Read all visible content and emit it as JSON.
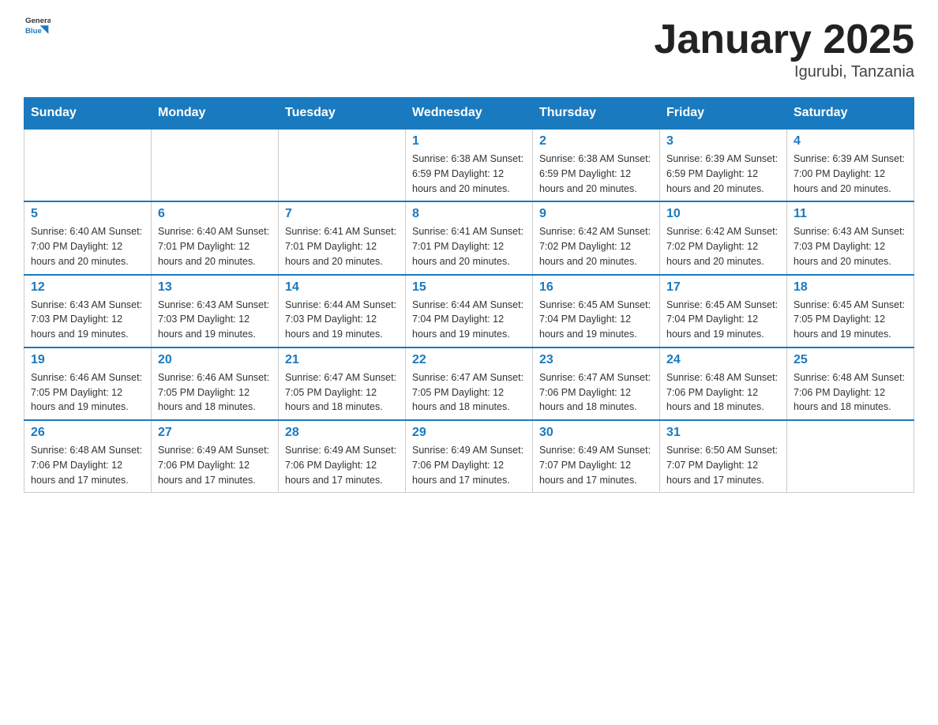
{
  "header": {
    "logo_text_general": "General",
    "logo_text_blue": "Blue",
    "month_title": "January 2025",
    "location": "Igurubi, Tanzania"
  },
  "weekdays": [
    "Sunday",
    "Monday",
    "Tuesday",
    "Wednesday",
    "Thursday",
    "Friday",
    "Saturday"
  ],
  "weeks": [
    [
      {
        "day": "",
        "info": ""
      },
      {
        "day": "",
        "info": ""
      },
      {
        "day": "",
        "info": ""
      },
      {
        "day": "1",
        "info": "Sunrise: 6:38 AM\nSunset: 6:59 PM\nDaylight: 12 hours\nand 20 minutes."
      },
      {
        "day": "2",
        "info": "Sunrise: 6:38 AM\nSunset: 6:59 PM\nDaylight: 12 hours\nand 20 minutes."
      },
      {
        "day": "3",
        "info": "Sunrise: 6:39 AM\nSunset: 6:59 PM\nDaylight: 12 hours\nand 20 minutes."
      },
      {
        "day": "4",
        "info": "Sunrise: 6:39 AM\nSunset: 7:00 PM\nDaylight: 12 hours\nand 20 minutes."
      }
    ],
    [
      {
        "day": "5",
        "info": "Sunrise: 6:40 AM\nSunset: 7:00 PM\nDaylight: 12 hours\nand 20 minutes."
      },
      {
        "day": "6",
        "info": "Sunrise: 6:40 AM\nSunset: 7:01 PM\nDaylight: 12 hours\nand 20 minutes."
      },
      {
        "day": "7",
        "info": "Sunrise: 6:41 AM\nSunset: 7:01 PM\nDaylight: 12 hours\nand 20 minutes."
      },
      {
        "day": "8",
        "info": "Sunrise: 6:41 AM\nSunset: 7:01 PM\nDaylight: 12 hours\nand 20 minutes."
      },
      {
        "day": "9",
        "info": "Sunrise: 6:42 AM\nSunset: 7:02 PM\nDaylight: 12 hours\nand 20 minutes."
      },
      {
        "day": "10",
        "info": "Sunrise: 6:42 AM\nSunset: 7:02 PM\nDaylight: 12 hours\nand 20 minutes."
      },
      {
        "day": "11",
        "info": "Sunrise: 6:43 AM\nSunset: 7:03 PM\nDaylight: 12 hours\nand 20 minutes."
      }
    ],
    [
      {
        "day": "12",
        "info": "Sunrise: 6:43 AM\nSunset: 7:03 PM\nDaylight: 12 hours\nand 19 minutes."
      },
      {
        "day": "13",
        "info": "Sunrise: 6:43 AM\nSunset: 7:03 PM\nDaylight: 12 hours\nand 19 minutes."
      },
      {
        "day": "14",
        "info": "Sunrise: 6:44 AM\nSunset: 7:03 PM\nDaylight: 12 hours\nand 19 minutes."
      },
      {
        "day": "15",
        "info": "Sunrise: 6:44 AM\nSunset: 7:04 PM\nDaylight: 12 hours\nand 19 minutes."
      },
      {
        "day": "16",
        "info": "Sunrise: 6:45 AM\nSunset: 7:04 PM\nDaylight: 12 hours\nand 19 minutes."
      },
      {
        "day": "17",
        "info": "Sunrise: 6:45 AM\nSunset: 7:04 PM\nDaylight: 12 hours\nand 19 minutes."
      },
      {
        "day": "18",
        "info": "Sunrise: 6:45 AM\nSunset: 7:05 PM\nDaylight: 12 hours\nand 19 minutes."
      }
    ],
    [
      {
        "day": "19",
        "info": "Sunrise: 6:46 AM\nSunset: 7:05 PM\nDaylight: 12 hours\nand 19 minutes."
      },
      {
        "day": "20",
        "info": "Sunrise: 6:46 AM\nSunset: 7:05 PM\nDaylight: 12 hours\nand 18 minutes."
      },
      {
        "day": "21",
        "info": "Sunrise: 6:47 AM\nSunset: 7:05 PM\nDaylight: 12 hours\nand 18 minutes."
      },
      {
        "day": "22",
        "info": "Sunrise: 6:47 AM\nSunset: 7:05 PM\nDaylight: 12 hours\nand 18 minutes."
      },
      {
        "day": "23",
        "info": "Sunrise: 6:47 AM\nSunset: 7:06 PM\nDaylight: 12 hours\nand 18 minutes."
      },
      {
        "day": "24",
        "info": "Sunrise: 6:48 AM\nSunset: 7:06 PM\nDaylight: 12 hours\nand 18 minutes."
      },
      {
        "day": "25",
        "info": "Sunrise: 6:48 AM\nSunset: 7:06 PM\nDaylight: 12 hours\nand 18 minutes."
      }
    ],
    [
      {
        "day": "26",
        "info": "Sunrise: 6:48 AM\nSunset: 7:06 PM\nDaylight: 12 hours\nand 17 minutes."
      },
      {
        "day": "27",
        "info": "Sunrise: 6:49 AM\nSunset: 7:06 PM\nDaylight: 12 hours\nand 17 minutes."
      },
      {
        "day": "28",
        "info": "Sunrise: 6:49 AM\nSunset: 7:06 PM\nDaylight: 12 hours\nand 17 minutes."
      },
      {
        "day": "29",
        "info": "Sunrise: 6:49 AM\nSunset: 7:06 PM\nDaylight: 12 hours\nand 17 minutes."
      },
      {
        "day": "30",
        "info": "Sunrise: 6:49 AM\nSunset: 7:07 PM\nDaylight: 12 hours\nand 17 minutes."
      },
      {
        "day": "31",
        "info": "Sunrise: 6:50 AM\nSunset: 7:07 PM\nDaylight: 12 hours\nand 17 minutes."
      },
      {
        "day": "",
        "info": ""
      }
    ]
  ]
}
